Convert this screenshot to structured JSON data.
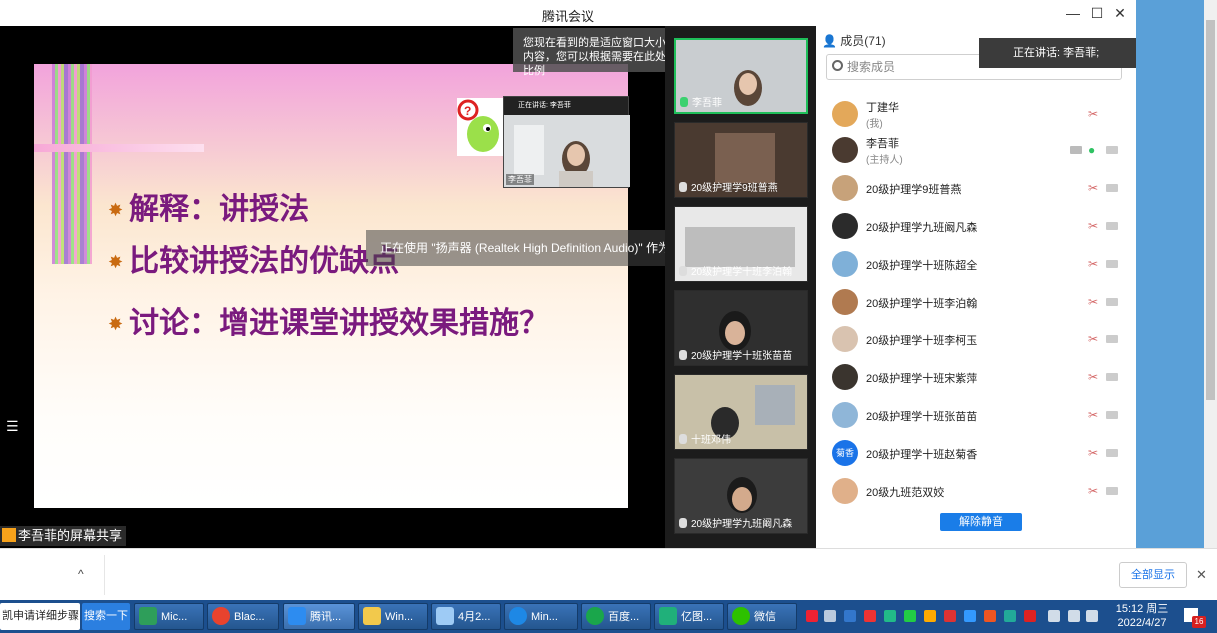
{
  "window": {
    "title": "腾讯会议",
    "min": "—",
    "max": "☐",
    "close": "✕"
  },
  "resize_tip": "您现在看到的是适应窗口大小缩放后的共享内容，您可以根据需要在此处调整画面缩放比例",
  "slide": {
    "bullets": [
      "解释：讲授法",
      "比较讲授法的优缺点",
      "讨论：增进课堂讲授效果措施？"
    ],
    "pip_bar": "正在讲话: 李吾菲",
    "pip_name": "李吾菲"
  },
  "sound_toast": "正在使用 \"扬声器 (Realtek High Definition Audio)\" 作为您的扬声器",
  "share_label": "李吾菲的屏幕共享",
  "menu_icon": "☰",
  "tiles": [
    {
      "name": "李吾菲"
    },
    {
      "name": "20级护理学9班普燕"
    },
    {
      "name": "20级护理学十班李泊翰"
    },
    {
      "name": "20级护理学十班张苗苗"
    },
    {
      "name": "十班邓伟"
    },
    {
      "name": "20级护理学九班阚凡森"
    }
  ],
  "members": {
    "header": "成员(71)",
    "search_placeholder": "搜索成员",
    "list": [
      {
        "name": "丁建华",
        "sub": "(我)"
      },
      {
        "name": "李吾菲",
        "sub": "(主持人)"
      },
      {
        "name": "20级护理学9班普燕"
      },
      {
        "name": "20级护理学九班阚凡森"
      },
      {
        "name": "20级护理学十班陈超全"
      },
      {
        "name": "20级护理学十班李泊翰"
      },
      {
        "name": "20级护理学十班李柯玉"
      },
      {
        "name": "20级护理学十班宋紫萍"
      },
      {
        "name": "20级护理学十班张苗苗"
      },
      {
        "name": "20级护理学十班赵菊香",
        "avatar": "菊香"
      },
      {
        "name": "20级九班范双姣"
      }
    ],
    "unmute_all": "解除静音"
  },
  "speaking_toast": "正在讲话: 李吾菲;",
  "download_bar": {
    "chevron": "^",
    "show_all": "全部显示",
    "close": "✕"
  },
  "taskbar": {
    "search_text": "凯申请详细步骤",
    "search_btn": "搜索一下",
    "apps": [
      "Mic...",
      "Blac...",
      "腾讯...",
      "Win...",
      "4月2...",
      "Min...",
      "百度...",
      "亿图...",
      "微信"
    ],
    "clock_time": "15:12 周三",
    "clock_date": "2022/4/27",
    "notif_count": "16"
  }
}
